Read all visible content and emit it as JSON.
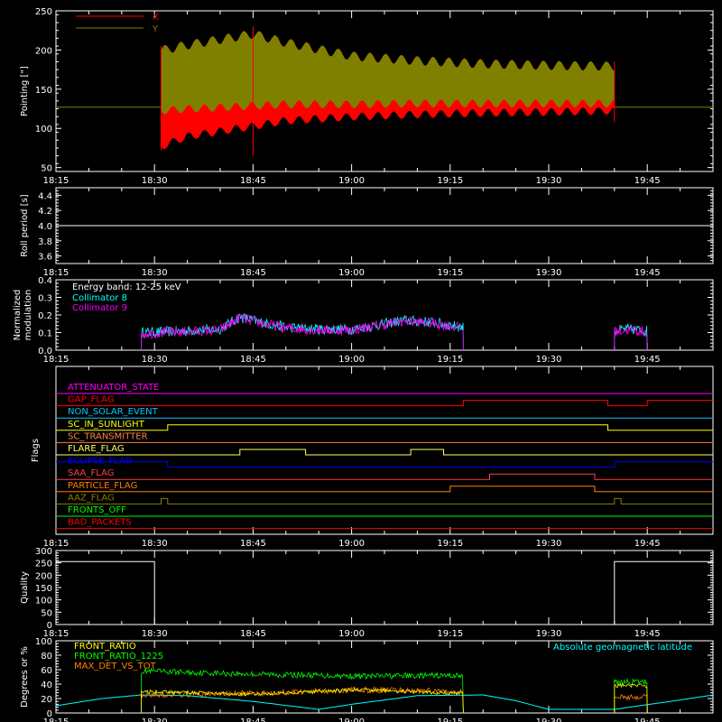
{
  "time_axis": {
    "range": [
      "18:15",
      "19:55"
    ],
    "tick_labels": [
      "18:15",
      "18:30",
      "18:45",
      "19:00",
      "19:15",
      "19:30",
      "19:45"
    ]
  },
  "chart_data": [
    {
      "id": "pointing",
      "type": "line",
      "ylabel": "Pointing [\"]",
      "ylim": [
        45,
        250
      ],
      "yticks": [
        50,
        100,
        150,
        200,
        250
      ],
      "legend": {
        "placement": "top-left",
        "entries": [
          {
            "name": "X",
            "color": "#ff0000"
          },
          {
            "name": "Y",
            "color": "#808000"
          }
        ]
      },
      "baseline_value": 127,
      "data_interval": [
        "18:31",
        "19:40"
      ],
      "x_band": {
        "times": [
          "18:31",
          "18:35",
          "18:45",
          "18:50",
          "19:00",
          "19:10",
          "19:20",
          "19:30",
          "19:40"
        ],
        "upper": [
          205,
          212,
          226,
          215,
          198,
          192,
          188,
          186,
          185
        ],
        "lower": [
          72,
          85,
          98,
          105,
          110,
          113,
          115,
          116,
          118
        ]
      },
      "y_band": {
        "times": [
          "18:31",
          "18:35",
          "18:45",
          "18:50",
          "19:00",
          "19:10",
          "19:20",
          "19:30",
          "19:40"
        ],
        "upper": [
          205,
          212,
          226,
          215,
          198,
          192,
          188,
          186,
          185
        ],
        "lower": [
          118,
          120,
          124,
          126,
          126,
          127,
          127,
          127,
          127
        ]
      },
      "spikes": [
        {
          "time": "18:45",
          "min": 65,
          "max": 230
        }
      ]
    },
    {
      "id": "roll_period",
      "type": "line",
      "ylabel": "Roll period [s]",
      "ylim": [
        3.5,
        4.5
      ],
      "yticks": [
        3.6,
        3.8,
        4.0,
        4.2,
        4.4
      ],
      "series": [
        {
          "color": "#ffffff",
          "x": [
            "18:15",
            "19:55"
          ],
          "values": [
            4.0,
            4.0
          ]
        }
      ]
    },
    {
      "id": "modulation",
      "type": "line",
      "ylabel": [
        "Normalized",
        "modulation"
      ],
      "ylim": [
        0,
        0.4
      ],
      "yticks": [
        0.0,
        0.1,
        0.2,
        0.3,
        0.4
      ],
      "annotation": "Energy band: 12-25 keV",
      "legend": {
        "placement": "top-left",
        "entries": [
          {
            "name": "Collimator 8",
            "color": "#00ffff"
          },
          {
            "name": "Collimator 9",
            "color": "#ff00ff"
          }
        ]
      },
      "segments": [
        {
          "start": "18:28",
          "end": "19:17",
          "times": [
            "18:28",
            "18:35",
            "18:40",
            "18:43",
            "18:46",
            "18:50",
            "18:55",
            "19:00",
            "19:05",
            "19:08",
            "19:12",
            "19:17"
          ],
          "values": [
            0.1,
            0.11,
            0.12,
            0.19,
            0.16,
            0.13,
            0.12,
            0.12,
            0.15,
            0.17,
            0.16,
            0.13
          ]
        },
        {
          "start": "19:40",
          "end": "19:45",
          "times": [
            "19:40",
            "19:42",
            "19:45"
          ],
          "values": [
            0.11,
            0.12,
            0.11
          ]
        }
      ]
    },
    {
      "id": "flags",
      "type": "timeline",
      "ylabel": "Flags",
      "rows": [
        {
          "name": "ATTENUATOR_STATE",
          "color": "#ff00ff",
          "transitions": [
            [
              "18:15",
              0
            ]
          ]
        },
        {
          "name": "GAP_FLAG",
          "color": "#ff0000",
          "transitions": [
            [
              "18:15",
              0
            ],
            [
              "19:17",
              1
            ],
            [
              "19:39",
              0
            ],
            [
              "19:45",
              1
            ]
          ]
        },
        {
          "name": "NON_SOLAR_EVENT",
          "color": "#00c8ff",
          "transitions": [
            [
              "18:15",
              0
            ]
          ]
        },
        {
          "name": "SC_IN_SUNLIGHT",
          "color": "#ffff00",
          "transitions": [
            [
              "18:15",
              0
            ],
            [
              "18:32",
              1
            ],
            [
              "19:39",
              0
            ]
          ]
        },
        {
          "name": "SC_TRANSMITTER",
          "color": "#ff8040",
          "transitions": [
            [
              "18:15",
              0
            ]
          ]
        },
        {
          "name": "FLARE_FLAG",
          "color": "#ffff60",
          "transitions": [
            [
              "18:15",
              0
            ],
            [
              "18:43",
              1
            ],
            [
              "18:53",
              0
            ],
            [
              "19:09",
              1
            ],
            [
              "19:14",
              0
            ]
          ]
        },
        {
          "name": "ECLIPSE_FLAG",
          "color": "#0000ff",
          "transitions": [
            [
              "18:15",
              1
            ],
            [
              "18:32",
              0
            ],
            [
              "19:40",
              1
            ]
          ]
        },
        {
          "name": "SAA_FLAG",
          "color": "#ff4040",
          "transitions": [
            [
              "18:15",
              0
            ],
            [
              "19:21",
              1
            ],
            [
              "19:37",
              0
            ]
          ]
        },
        {
          "name": "PARTICLE_FLAG",
          "color": "#ff8000",
          "transitions": [
            [
              "18:15",
              0
            ],
            [
              "19:15",
              1
            ],
            [
              "19:37",
              0
            ]
          ]
        },
        {
          "name": "AAZ_FLAG",
          "color": "#808000",
          "transitions": [
            [
              "18:15",
              0
            ],
            [
              "18:31",
              1
            ],
            [
              "18:32",
              0
            ],
            [
              "19:40",
              1
            ],
            [
              "19:41",
              0
            ]
          ]
        },
        {
          "name": "FRONTS_OFF",
          "color": "#00ff00",
          "transitions": [
            [
              "18:15",
              0
            ]
          ]
        },
        {
          "name": "BAD_PACKETS",
          "color": "#ff0000",
          "transitions": [
            [
              "18:15",
              0
            ]
          ]
        }
      ]
    },
    {
      "id": "quality",
      "type": "line",
      "ylabel": "Quality",
      "ylim": [
        0,
        300
      ],
      "yticks": [
        0,
        50,
        100,
        150,
        200,
        250,
        300
      ],
      "series": [
        {
          "color": "#ffffff",
          "x": [
            "18:15",
            "18:30",
            "18:30",
            "19:40",
            "19:40",
            "19:55"
          ],
          "values": [
            255,
            255,
            0,
            0,
            255,
            255
          ]
        }
      ]
    },
    {
      "id": "ratios",
      "type": "line",
      "ylabel": "Degrees or %",
      "ylim": [
        0,
        100
      ],
      "yticks": [
        0,
        20,
        40,
        60,
        80,
        100
      ],
      "annotation": "Absolute geomagnetic latitude",
      "legend": {
        "placement": "top-left",
        "entries": [
          {
            "name": "FRONT_RATIO",
            "color": "#ffff00"
          },
          {
            "name": "FRONT_RATIO_1225",
            "color": "#00ff00"
          },
          {
            "name": "MAX_DET_VS_TOT",
            "color": "#ff8000"
          }
        ]
      },
      "latitude": {
        "color": "#00ffff",
        "times": [
          "18:15",
          "18:22",
          "18:28",
          "18:35",
          "18:45",
          "18:55",
          "19:00",
          "19:10",
          "19:20",
          "19:25",
          "19:30",
          "19:40",
          "19:50",
          "19:55"
        ],
        "values": [
          10,
          20,
          25,
          24,
          16,
          5,
          12,
          24,
          25,
          17,
          5,
          5,
          18,
          25
        ]
      },
      "segments": [
        {
          "start": "18:28",
          "end": "19:17",
          "front_ratio": [
            30,
            26,
            32,
            27
          ],
          "front_ratio_1225": [
            58,
            54,
            51,
            52
          ],
          "max_det_vs_tot": [
            25,
            27,
            32,
            30
          ]
        },
        {
          "start": "19:40",
          "end": "19:45",
          "front_ratio": [
            38,
            38
          ],
          "front_ratio_1225": [
            43,
            43
          ],
          "max_det_vs_tot": [
            22,
            22
          ]
        }
      ]
    }
  ]
}
